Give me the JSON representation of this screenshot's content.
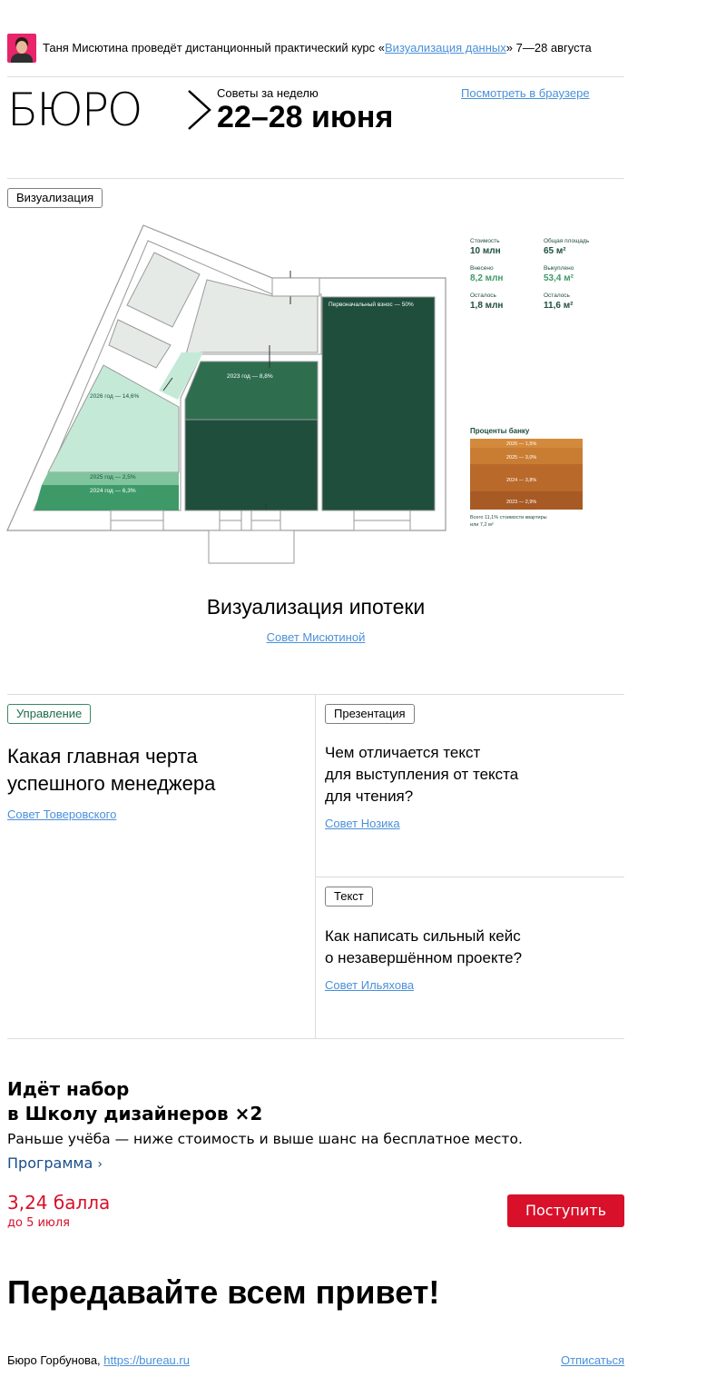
{
  "promo": {
    "text_before": "Таня Мисютина проведёт дистанционный практический курс «",
    "link": "Визуализация данных",
    "text_after": "» 7—28 августа"
  },
  "header": {
    "logo": "БЮРО",
    "subtitle": "Советы за неделю",
    "dates": "22–28 июня",
    "browser_link": "Посмотреть в браузере"
  },
  "feature": {
    "tag": "Визуализация",
    "title": "Визуализация ипотеки",
    "byline": "Совет Мисютиной",
    "plan": {
      "labels": {
        "initial": "Первоначальный взнос — 50%",
        "y2023": "2023 год — 8,8%",
        "y2026": "2026 год — 14,6%",
        "y2025": "2025 год — 2,5%",
        "y2024": "2024 год — 6,3%"
      },
      "stats": [
        {
          "label": "Стоимость",
          "value": "10 млн",
          "color": "#1f4e3d"
        },
        {
          "label": "Общая площадь",
          "value": "65 м²",
          "color": "#1f4e3d"
        },
        {
          "label": "Внесено",
          "value": "8,2 млн",
          "color": "#3d9a68"
        },
        {
          "label": "Выкуплено",
          "value": "53,4 м²",
          "color": "#3d9a68"
        },
        {
          "label": "Осталось",
          "value": "1,8 млн",
          "color": "#1f4e3d"
        },
        {
          "label": "Осталось",
          "value": "11,6 м²",
          "color": "#1f4e3d"
        }
      ],
      "bank": {
        "title": "Проценты банку",
        "rows": [
          "2026 — 1,5%",
          "2025 — 3,0%",
          "2024 — 3,8%",
          "2023 — 2,9%"
        ],
        "colors": [
          "#d48a3c",
          "#c97d33",
          "#b9692a",
          "#a85a25"
        ],
        "note_line1": "Всего 11,1% стоимости квартиры",
        "note_line2": "или 7,2 м²"
      }
    }
  },
  "cards": [
    {
      "tag": "Управление",
      "title": "Какая главная черта\nуспешного менеджера",
      "byline": "Совет Товеровского"
    },
    {
      "tag": "Презентация",
      "title": "Чем отличается текст\nдля выступления от текста\nдля чтения?",
      "byline": "Совет Нозика"
    },
    {
      "tag": "Текст",
      "title": "Как написать сильный кейс\nо незавершённом проекте?",
      "byline": "Совет Ильяхова"
    }
  ],
  "school": {
    "line1": "Идёт набор",
    "line2": "в Школу дизайнеров",
    "x2": "×2",
    "desc": "Раньше учёба — ниже стоимость и выше шанс на бесплатное место.",
    "program": "Программа",
    "score": "3,24 балла",
    "deadline": "до 5 июля",
    "button": "Поступить"
  },
  "farewell": "Передавайте всем привет!",
  "footer": {
    "company": "Бюро Горбунова,",
    "url": "https://bureau.ru",
    "unsubscribe": "Отписаться"
  },
  "colors": {
    "link": "#4a90d9",
    "dark_green": "#1f4e3d",
    "mid_green": "#2e6e4f",
    "green": "#3d9a68",
    "light_green": "#c4ead7",
    "red": "#d8102a"
  }
}
